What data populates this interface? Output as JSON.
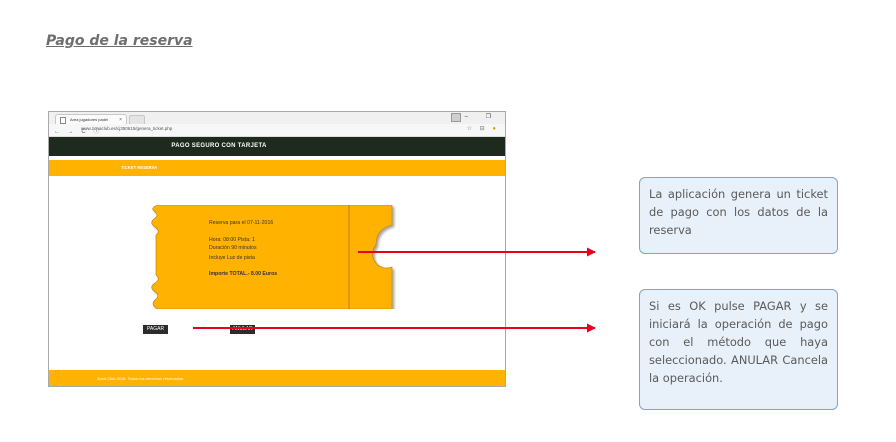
{
  "doc": {
    "title": "Pago de la reserva"
  },
  "browser": {
    "tab_title": "Area jugadores padel",
    "tab_close": "×",
    "window_controls": "–  ❐",
    "nav_icons": "← → C ⓘ",
    "url": "www.zonaclub.es/cj350615/genera_ticket.php",
    "url_icons": "☆ ⊟"
  },
  "page": {
    "header_title": "PAGO SEGURO CON TARJETA",
    "ticket_bar_label": "TICKET RESERVA",
    "ticket": {
      "date_line": "Reserva para el 07-11-2016",
      "time_line": "Hora: 08:00    Pista: 1",
      "duration_line": "Duración 90 minutos",
      "light_line": "Incluye Luz de pista",
      "amount_line": "Importe TOTAL.- 8.00 Euros"
    },
    "pay_button": "PAGAR",
    "cancel_button": "ANULAR",
    "footer_text": "Zona Club 2016. Todos los derechos reservados."
  },
  "callouts": {
    "first": "La aplicación genera un ticket de pago con los datos de la reserva",
    "second": "Si es OK pulse PAGAR y se iniciará la operación de pago con el método que haya seleccionado. ANULAR Cancela la operación."
  },
  "colors": {
    "accent_orange": "#ffb300",
    "header_dark": "#1d2a1d",
    "arrow_red": "#e8001c",
    "callout_border": "#7aa6d6",
    "callout_fill": "#e8f0fa"
  }
}
